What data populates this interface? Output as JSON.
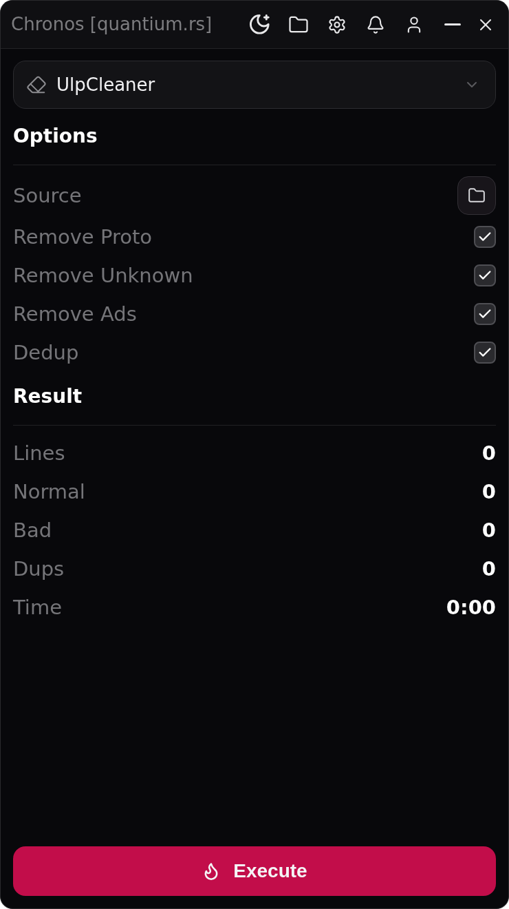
{
  "window": {
    "title": "Chronos [quantium.rs]"
  },
  "module_select": {
    "value": "UlpCleaner"
  },
  "options": {
    "heading": "Options",
    "items": [
      {
        "kind": "folder",
        "label": "Source"
      },
      {
        "kind": "checkbox",
        "label": "Remove Proto",
        "checked": true
      },
      {
        "kind": "checkbox",
        "label": "Remove Unknown",
        "checked": true
      },
      {
        "kind": "checkbox",
        "label": "Remove Ads",
        "checked": true
      },
      {
        "kind": "checkbox",
        "label": "Dedup",
        "checked": true
      }
    ]
  },
  "result": {
    "heading": "Result",
    "rows": [
      {
        "label": "Lines",
        "value": "0"
      },
      {
        "label": "Normal",
        "value": "0"
      },
      {
        "label": "Bad",
        "value": "0"
      },
      {
        "label": "Dups",
        "value": "0"
      },
      {
        "label": "Time",
        "value": "0:00"
      }
    ]
  },
  "execute_button": {
    "label": "Execute"
  }
}
